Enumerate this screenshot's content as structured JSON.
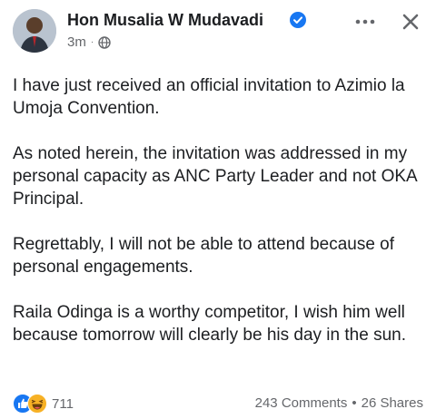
{
  "post": {
    "author": "Hon Musalia W Mudavadi",
    "time": "3m",
    "separator": "·",
    "paragraphs": [
      "I have just received an official invitation to Azimio la Umoja Convention.",
      "As noted herein, the invitation was addressed in my personal capacity as ANC Party Leader and not OKA Principal.",
      "Regrettably, I will not be able to attend because of personal engagements.",
      "Raila Odinga is a worthy competitor, I wish him well because tomorrow will clearly be his day in the sun."
    ],
    "reaction_count": "711",
    "comments": "243 Comments",
    "shares": "26 Shares",
    "stats_separator": "•"
  },
  "icons": {
    "avatar": "avatar",
    "verified": "verified-badge-icon",
    "audience": "globe-icon",
    "more": "more-dots-icon",
    "close": "close-icon",
    "like": "like-reaction-icon",
    "haha": "haha-reaction-icon"
  },
  "colors": {
    "accent": "#1877f2",
    "text": "#1c1e21",
    "secondary": "#65676b",
    "haha": "#f7b125"
  }
}
